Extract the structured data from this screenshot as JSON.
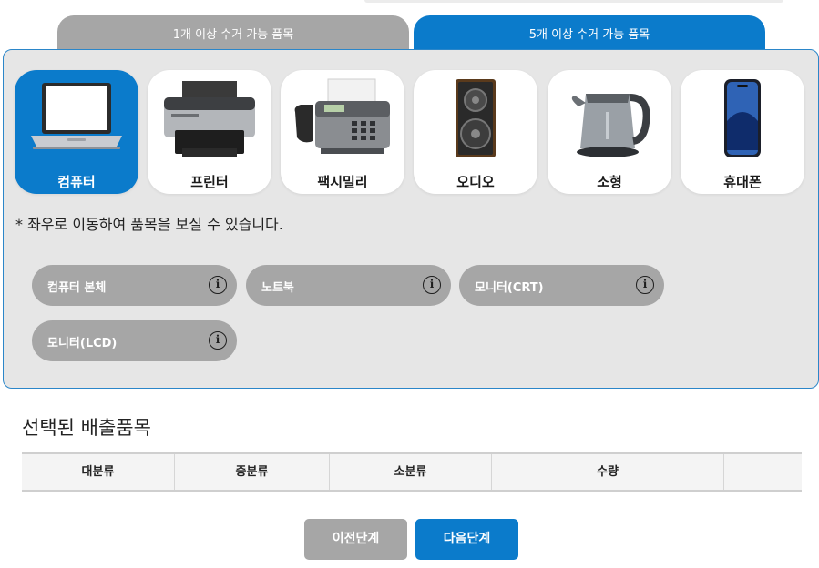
{
  "tabs": [
    {
      "label": "1개 이상 수거 가능 품목",
      "active": false
    },
    {
      "label": "5개 이상 수거 가능 품목",
      "active": true
    }
  ],
  "categories": [
    {
      "label": "컴퓨터",
      "icon": "laptop-icon",
      "selected": true
    },
    {
      "label": "프린터",
      "icon": "printer-icon",
      "selected": false
    },
    {
      "label": "팩시밀리",
      "icon": "fax-icon",
      "selected": false
    },
    {
      "label": "오디오",
      "icon": "speaker-icon",
      "selected": false
    },
    {
      "label": "소형",
      "icon": "kettle-icon",
      "selected": false
    },
    {
      "label": "휴대폰",
      "icon": "smartphone-icon",
      "selected": false
    }
  ],
  "scroll_note": "* 좌우로 이동하여 품목을 보실 수 있습니다.",
  "items": [
    {
      "label": "컴퓨터 본체",
      "info": "i"
    },
    {
      "label": "노트북",
      "info": "i"
    },
    {
      "label": "모니터(CRT)",
      "info": "i"
    },
    {
      "label": "모니터(LCD)",
      "info": "i"
    }
  ],
  "selected_section": {
    "title": "선택된 배출품목",
    "columns": [
      "대분류",
      "중분류",
      "소분류",
      "수량",
      ""
    ]
  },
  "buttons": {
    "prev": "이전단계",
    "next": "다음단계"
  },
  "colors": {
    "accent": "#0b7bcb",
    "inactive": "#a6a6a6",
    "panel": "#e6e6e6"
  }
}
